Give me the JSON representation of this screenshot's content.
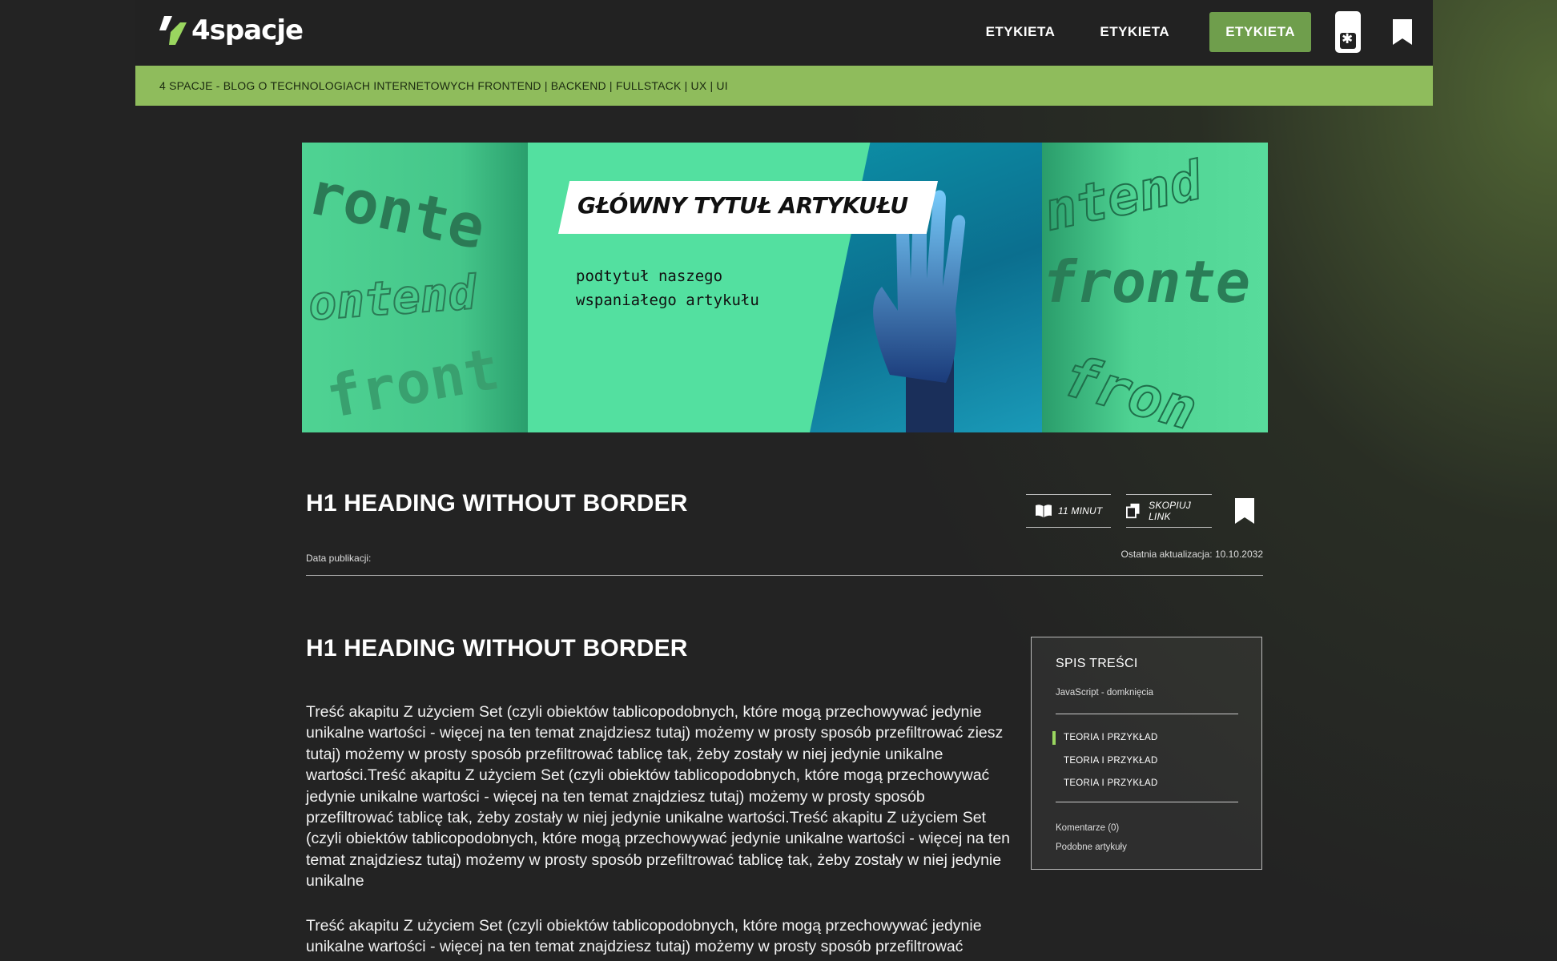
{
  "header": {
    "logo_text": "4spacje",
    "nav": [
      "ETYKIETA",
      "ETYKIETA",
      "ETYKIETA"
    ],
    "active_index": 2
  },
  "tagline": "4 SPACJE - BLOG O TECHNOLOGIACH INTERNETOWYCH FRONTEND | BACKEND | FULLSTACK | UX | UI",
  "banner": {
    "title": "GŁÓWNY TYTUŁ ARTYKUŁU",
    "subtitle_line1": "podtytuł naszego",
    "subtitle_line2": "wspaniałego artykułu",
    "bg_words": [
      "ronte",
      "ontend",
      "front",
      "ntend",
      "fronte",
      "fron"
    ]
  },
  "article": {
    "heading": "H1 HEADING WITHOUT BORDER",
    "read_time": "11 MINUT",
    "copy_link": "SKOPIUJ LINK",
    "published_label": "Data publikacji:",
    "updated": "Ostatnia aktualizacja: 10.10.2032",
    "section_heading": "H1 HEADING WITHOUT BORDER",
    "paragraph_1": "Treść akapitu Z użyciem Set (czyli obiektów tablicopodobnych, które mogą przechowywać jedynie unikalne wartości - więcej na ten temat znajdziesz tutaj) możemy w prosty sposób przefiltrować ziesz tutaj) możemy w prosty sposób przefiltrować tablicę tak, żeby zostały w niej jedynie unikalne wartości.Treść akapitu Z użyciem Set (czyli obiektów tablicopodobnych, które mogą przechowywać jedynie unikalne wartości - więcej na ten temat znajdziesz tutaj) możemy w prosty sposób przefiltrować tablicę tak, żeby zostały w niej jedynie unikalne wartości.Treść akapitu Z użyciem Set (czyli obiektów tablicopodobnych, które mogą przechowywać jedynie unikalne wartości - więcej na ten temat znajdziesz tutaj) możemy w prosty sposób przefiltrować tablicę tak, żeby zostały w niej jedynie unikalne",
    "paragraph_2": "Treść akapitu Z użyciem Set (czyli obiektów tablicopodobnych, które mogą przechowywać jedynie unikalne wartości - więcej na ten temat znajdziesz tutaj) możemy w prosty sposób przefiltrować"
  },
  "toc": {
    "title": "SPIS TREŚCI",
    "subtitle": "JavaScript - domknięcia",
    "items": [
      "TEORIA I PRZYKŁAD",
      "TEORIA I PRZYKŁAD",
      "TEORIA I PRZYKŁAD"
    ],
    "comments": "Komentarze (0)",
    "similar": "Podobne artykuły"
  },
  "colors": {
    "accent": "#8fbc5c",
    "active_nav": "#6f9e4c",
    "toc_marker": "#9ad65f",
    "banner": "#53e0a0"
  }
}
